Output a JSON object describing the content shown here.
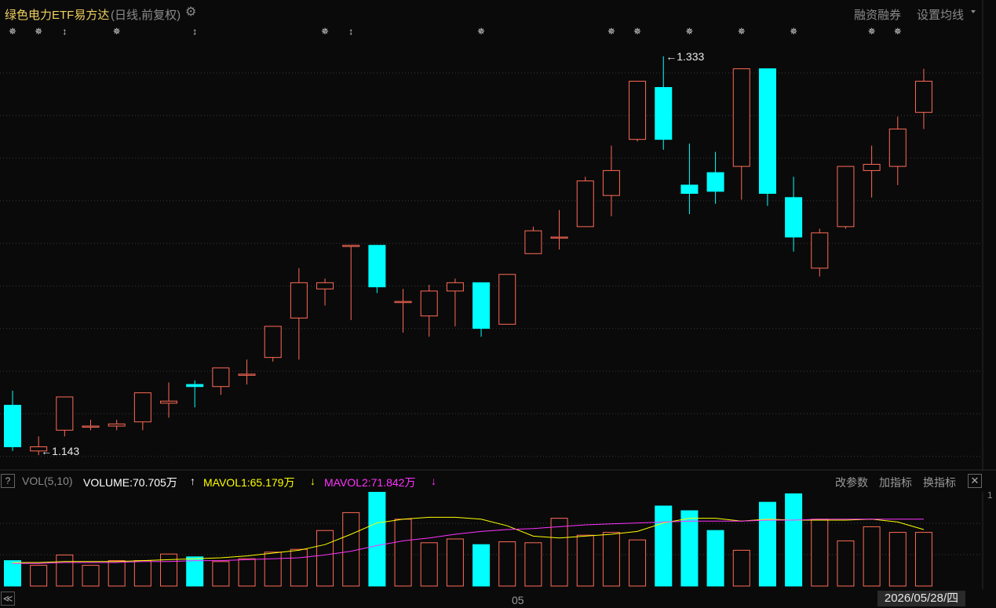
{
  "header": {
    "title": "绿色电力ETF易方达",
    "subtitle": "(日线,前复权)",
    "margin_link": "融资融券",
    "ma_link": "设置均线"
  },
  "markers": [
    "✵",
    "✵",
    "↕",
    "✵",
    "↕",
    "✵",
    "↕",
    "✵",
    "✵",
    "✵",
    "✵",
    "✵",
    "✵",
    "✵",
    "✵"
  ],
  "chart_data": [
    {
      "type": "candlestick",
      "title": "绿色电力ETF易方达",
      "ylim": [
        1.135,
        1.345
      ],
      "annotations": [
        {
          "label": "1.333",
          "value": 1.333,
          "index": 25
        },
        {
          "label": "1.143",
          "value": 1.143,
          "index": 1
        }
      ],
      "up_color": "#ff6b57",
      "down_color": "#00ffff",
      "candles": [
        {
          "o": 1.165,
          "h": 1.172,
          "l": 1.143,
          "c": 1.145
        },
        {
          "o": 1.143,
          "h": 1.15,
          "l": 1.141,
          "c": 1.145
        },
        {
          "o": 1.153,
          "h": 1.169,
          "l": 1.15,
          "c": 1.169
        },
        {
          "o": 1.155,
          "h": 1.158,
          "l": 1.153,
          "c": 1.155
        },
        {
          "o": 1.155,
          "h": 1.158,
          "l": 1.153,
          "c": 1.156
        },
        {
          "o": 1.157,
          "h": 1.171,
          "l": 1.153,
          "c": 1.171
        },
        {
          "o": 1.166,
          "h": 1.176,
          "l": 1.159,
          "c": 1.167
        },
        {
          "o": 1.175,
          "h": 1.177,
          "l": 1.164,
          "c": 1.174
        },
        {
          "o": 1.174,
          "h": 1.183,
          "l": 1.17,
          "c": 1.183
        },
        {
          "o": 1.18,
          "h": 1.187,
          "l": 1.175,
          "c": 1.18
        },
        {
          "o": 1.188,
          "h": 1.203,
          "l": 1.186,
          "c": 1.203
        },
        {
          "o": 1.207,
          "h": 1.231,
          "l": 1.187,
          "c": 1.224
        },
        {
          "o": 1.221,
          "h": 1.226,
          "l": 1.213,
          "c": 1.224
        },
        {
          "o": 1.242,
          "h": 1.242,
          "l": 1.206,
          "c": 1.242
        },
        {
          "o": 1.242,
          "h": 1.242,
          "l": 1.219,
          "c": 1.222
        },
        {
          "o": 1.215,
          "h": 1.221,
          "l": 1.2,
          "c": 1.215
        },
        {
          "o": 1.208,
          "h": 1.223,
          "l": 1.198,
          "c": 1.22
        },
        {
          "o": 1.22,
          "h": 1.226,
          "l": 1.203,
          "c": 1.224
        },
        {
          "o": 1.224,
          "h": 1.224,
          "l": 1.198,
          "c": 1.202
        },
        {
          "o": 1.204,
          "h": 1.228,
          "l": 1.204,
          "c": 1.228
        },
        {
          "o": 1.238,
          "h": 1.251,
          "l": 1.238,
          "c": 1.249
        },
        {
          "o": 1.246,
          "h": 1.259,
          "l": 1.24,
          "c": 1.246
        },
        {
          "o": 1.251,
          "h": 1.275,
          "l": 1.251,
          "c": 1.273
        },
        {
          "o": 1.266,
          "h": 1.29,
          "l": 1.256,
          "c": 1.278
        },
        {
          "o": 1.293,
          "h": 1.309,
          "l": 1.292,
          "c": 1.321
        },
        {
          "o": 1.318,
          "h": 1.333,
          "l": 1.288,
          "c": 1.293
        },
        {
          "o": 1.271,
          "h": 1.291,
          "l": 1.257,
          "c": 1.267
        },
        {
          "o": 1.277,
          "h": 1.287,
          "l": 1.262,
          "c": 1.268
        },
        {
          "o": 1.28,
          "h": 1.327,
          "l": 1.264,
          "c": 1.327
        },
        {
          "o": 1.327,
          "h": 1.327,
          "l": 1.261,
          "c": 1.267
        },
        {
          "o": 1.265,
          "h": 1.275,
          "l": 1.239,
          "c": 1.246
        },
        {
          "o": 1.231,
          "h": 1.25,
          "l": 1.227,
          "c": 1.248
        },
        {
          "o": 1.251,
          "h": 1.28,
          "l": 1.25,
          "c": 1.28
        },
        {
          "o": 1.278,
          "h": 1.29,
          "l": 1.265,
          "c": 1.281
        },
        {
          "o": 1.28,
          "h": 1.304,
          "l": 1.271,
          "c": 1.298
        },
        {
          "o": 1.306,
          "h": 1.327,
          "l": 1.298,
          "c": 1.321
        }
      ]
    },
    {
      "type": "bar",
      "title": "VOL(5,10)",
      "ylim": [
        0,
        100
      ],
      "series": [
        {
          "name": "VOLUME",
          "values": [
            27,
            22,
            33,
            22,
            27,
            27,
            34,
            31,
            26,
            29,
            36,
            39,
            59,
            78,
            100,
            71,
            46,
            50,
            44,
            47,
            46,
            72,
            54,
            57,
            49,
            85,
            80,
            59,
            38,
            89,
            98,
            71,
            48,
            63,
            57,
            57
          ]
        },
        {
          "name": "MAVOL1",
          "values": [
            25,
            25,
            26,
            26,
            26,
            27,
            28,
            29,
            30,
            32,
            35,
            38,
            44,
            55,
            67,
            71,
            73,
            73,
            71,
            64,
            53,
            51,
            53,
            55,
            58,
            67,
            72,
            72,
            69,
            71,
            70,
            70,
            70,
            71,
            68,
            60
          ]
        },
        {
          "name": "MAVOL2",
          "values": [
            24,
            24,
            25,
            25,
            25,
            26,
            26,
            27,
            27,
            28,
            29,
            30,
            33,
            37,
            43,
            48,
            51,
            55,
            58,
            60,
            61,
            63,
            65,
            66,
            67,
            68,
            69,
            69,
            69,
            70,
            70,
            71,
            71,
            71,
            71,
            71
          ]
        }
      ],
      "labels": {
        "indicator": "VOL(5,10)",
        "volume": "VOLUME:70.705万",
        "mavol1": "MAVOL1:65.179万",
        "mavol2": "MAVOL2:71.842万",
        "arrow1": "↑",
        "arrow2": "↓",
        "arrow3": "↓",
        "y_tick": "1"
      },
      "colors": {
        "volume": "#ffffff",
        "mavol1": "#ffff00",
        "mavol2": "#ff33ff"
      }
    }
  ],
  "vol_buttons": {
    "change": "改参数",
    "add": "加指标",
    "switch": "换指标"
  },
  "bottom": {
    "nav": "≪",
    "x_label": "05",
    "date": "2026/05/28/四"
  }
}
